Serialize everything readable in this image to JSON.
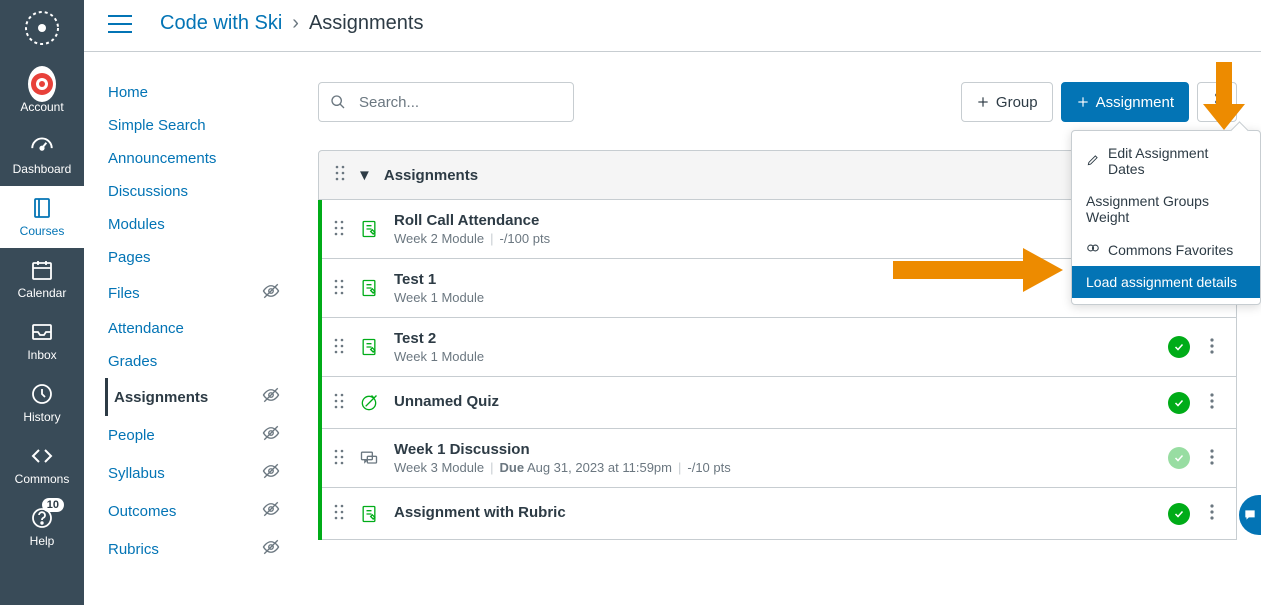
{
  "globalNav": {
    "items": [
      {
        "label": "Account",
        "icon": "avatar"
      },
      {
        "label": "Dashboard",
        "icon": "speedometer"
      },
      {
        "label": "Courses",
        "icon": "book",
        "active": true
      },
      {
        "label": "Calendar",
        "icon": "calendar"
      },
      {
        "label": "Inbox",
        "icon": "inbox"
      },
      {
        "label": "History",
        "icon": "clock"
      },
      {
        "label": "Commons",
        "icon": "commons"
      },
      {
        "label": "Help",
        "icon": "help",
        "badge": "10"
      }
    ]
  },
  "breadcrumb": {
    "course": "Code with Ski",
    "page": "Assignments"
  },
  "courseNav": {
    "items": [
      {
        "label": "Home"
      },
      {
        "label": "Simple Search"
      },
      {
        "label": "Announcements"
      },
      {
        "label": "Discussions"
      },
      {
        "label": "Modules"
      },
      {
        "label": "Pages"
      },
      {
        "label": "Files",
        "hidden": true
      },
      {
        "label": "Attendance"
      },
      {
        "label": "Grades"
      },
      {
        "label": "Assignments",
        "hidden": true,
        "active": true
      },
      {
        "label": "People",
        "hidden": true
      },
      {
        "label": "Syllabus",
        "hidden": true
      },
      {
        "label": "Outcomes",
        "hidden": true
      },
      {
        "label": "Rubrics",
        "hidden": true
      }
    ]
  },
  "toolbar": {
    "searchPlaceholder": "Search...",
    "groupBtn": "Group",
    "assignmentBtn": "Assignment"
  },
  "group": {
    "title": "Assignments"
  },
  "assignments": [
    {
      "title": "Roll Call Attendance",
      "module": "Week 2 Module",
      "points": "-/100 pts",
      "icon": "assignment",
      "published": true
    },
    {
      "title": "Test 1",
      "module": "Week 1 Module",
      "points": "",
      "icon": "assignment",
      "published": true
    },
    {
      "title": "Test 2",
      "module": "Week 1 Module",
      "points": "",
      "icon": "assignment",
      "published": true
    },
    {
      "title": "Unnamed Quiz",
      "module": "",
      "points": "",
      "icon": "quiz",
      "published": true
    },
    {
      "title": "Week 1 Discussion",
      "module": "Week 3 Module",
      "dueLabel": "Due",
      "due": "Aug 31, 2023 at 11:59pm",
      "points": "-/10 pts",
      "icon": "discussion",
      "published": true,
      "faded": true
    },
    {
      "title": "Assignment with Rubric",
      "module": "",
      "points": "",
      "icon": "assignment",
      "published": true
    }
  ],
  "dropdown": {
    "items": [
      {
        "label": "Edit Assignment Dates",
        "icon": "pencil"
      },
      {
        "label": "Assignment Groups Weight"
      },
      {
        "label": "Commons Favorites",
        "icon": "commons"
      },
      {
        "label": "Load assignment details",
        "highlight": true
      }
    ]
  }
}
